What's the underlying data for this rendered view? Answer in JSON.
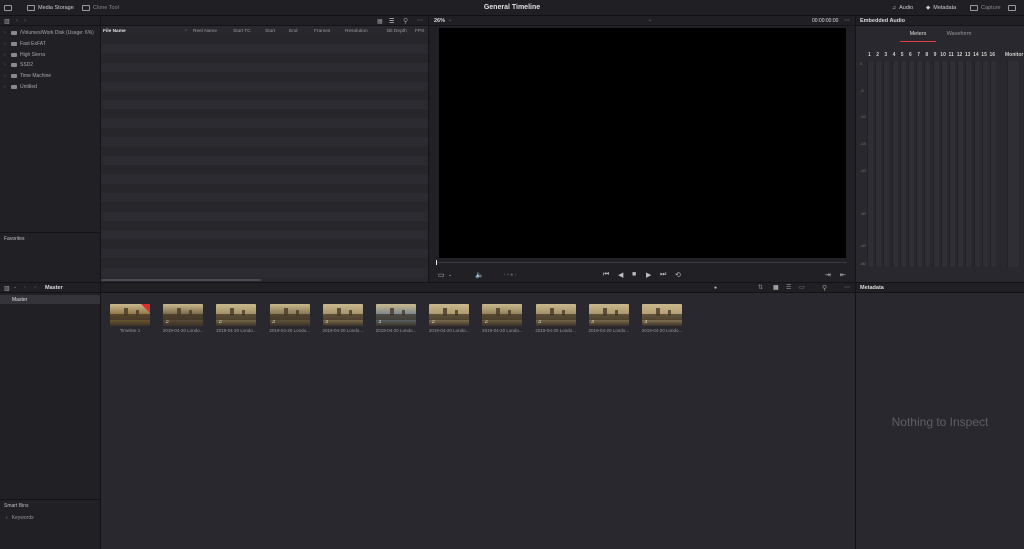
{
  "topbar": {
    "media_storage": "Media Storage",
    "clone_tool": "Clone Tool",
    "title": "General Timeline",
    "audio": "Audio",
    "metadata": "Metadata",
    "capture": "Capture"
  },
  "volumes": [
    {
      "label": "/Volumes/Work Disk (Usage: 6%)"
    },
    {
      "label": "Fast ExFAT"
    },
    {
      "label": "High Sierra"
    },
    {
      "label": "SSD2"
    },
    {
      "label": "Time Machine"
    },
    {
      "label": "Untitled"
    }
  ],
  "favorites": "Favorites",
  "file_columns": [
    "File Name",
    "Reel Name",
    "Start TC",
    "Start",
    "End",
    "Frames",
    "Resolution",
    "Bit Depth",
    "FPS"
  ],
  "viewer": {
    "zoom": "26%",
    "timecode": "00:00:00:00"
  },
  "audio_panel": {
    "title": "Embedded Audio",
    "tab_meters": "Meters",
    "tab_waveform": "Waveform",
    "channels": [
      "1",
      "2",
      "3",
      "4",
      "5",
      "6",
      "7",
      "8",
      "9",
      "10",
      "11",
      "12",
      "13",
      "14",
      "15",
      "16"
    ],
    "monitor": "Monitor",
    "scale": [
      "0",
      "-5",
      "-10",
      "-15",
      "-20",
      "-30",
      "-40",
      "-50"
    ]
  },
  "bins": {
    "master_header": "Master",
    "master_item": "Master",
    "smart_bins": "Smart Bins",
    "keywords": "Keywords"
  },
  "clips": [
    {
      "label": "Timeline 1",
      "tone": "#8a6a3a"
    },
    {
      "label": "2019-04-20 Londo...",
      "tone": "#6b5a3e"
    },
    {
      "label": "2019-04-20 Londo...",
      "tone": "#9c8a5e"
    },
    {
      "label": "2019-04-20 Londo...",
      "tone": "#7a6a48"
    },
    {
      "label": "2019-04-20 Londo...",
      "tone": "#a08c62"
    },
    {
      "label": "2019-04-20 Londo...",
      "tone": "#6d7d8e"
    },
    {
      "label": "2019-04-20 Londo...",
      "tone": "#a89468"
    },
    {
      "label": "2019-04-20 Londo...",
      "tone": "#8a7650"
    },
    {
      "label": "2019-04-20 Londo...",
      "tone": "#9c8860"
    },
    {
      "label": "2019-04-20 Londo...",
      "tone": "#a59066"
    },
    {
      "label": "2019-04-20 Londo...",
      "tone": "#b09a6c"
    }
  ],
  "metadata_panel": {
    "title": "Metadata",
    "empty": "Nothing to Inspect"
  }
}
